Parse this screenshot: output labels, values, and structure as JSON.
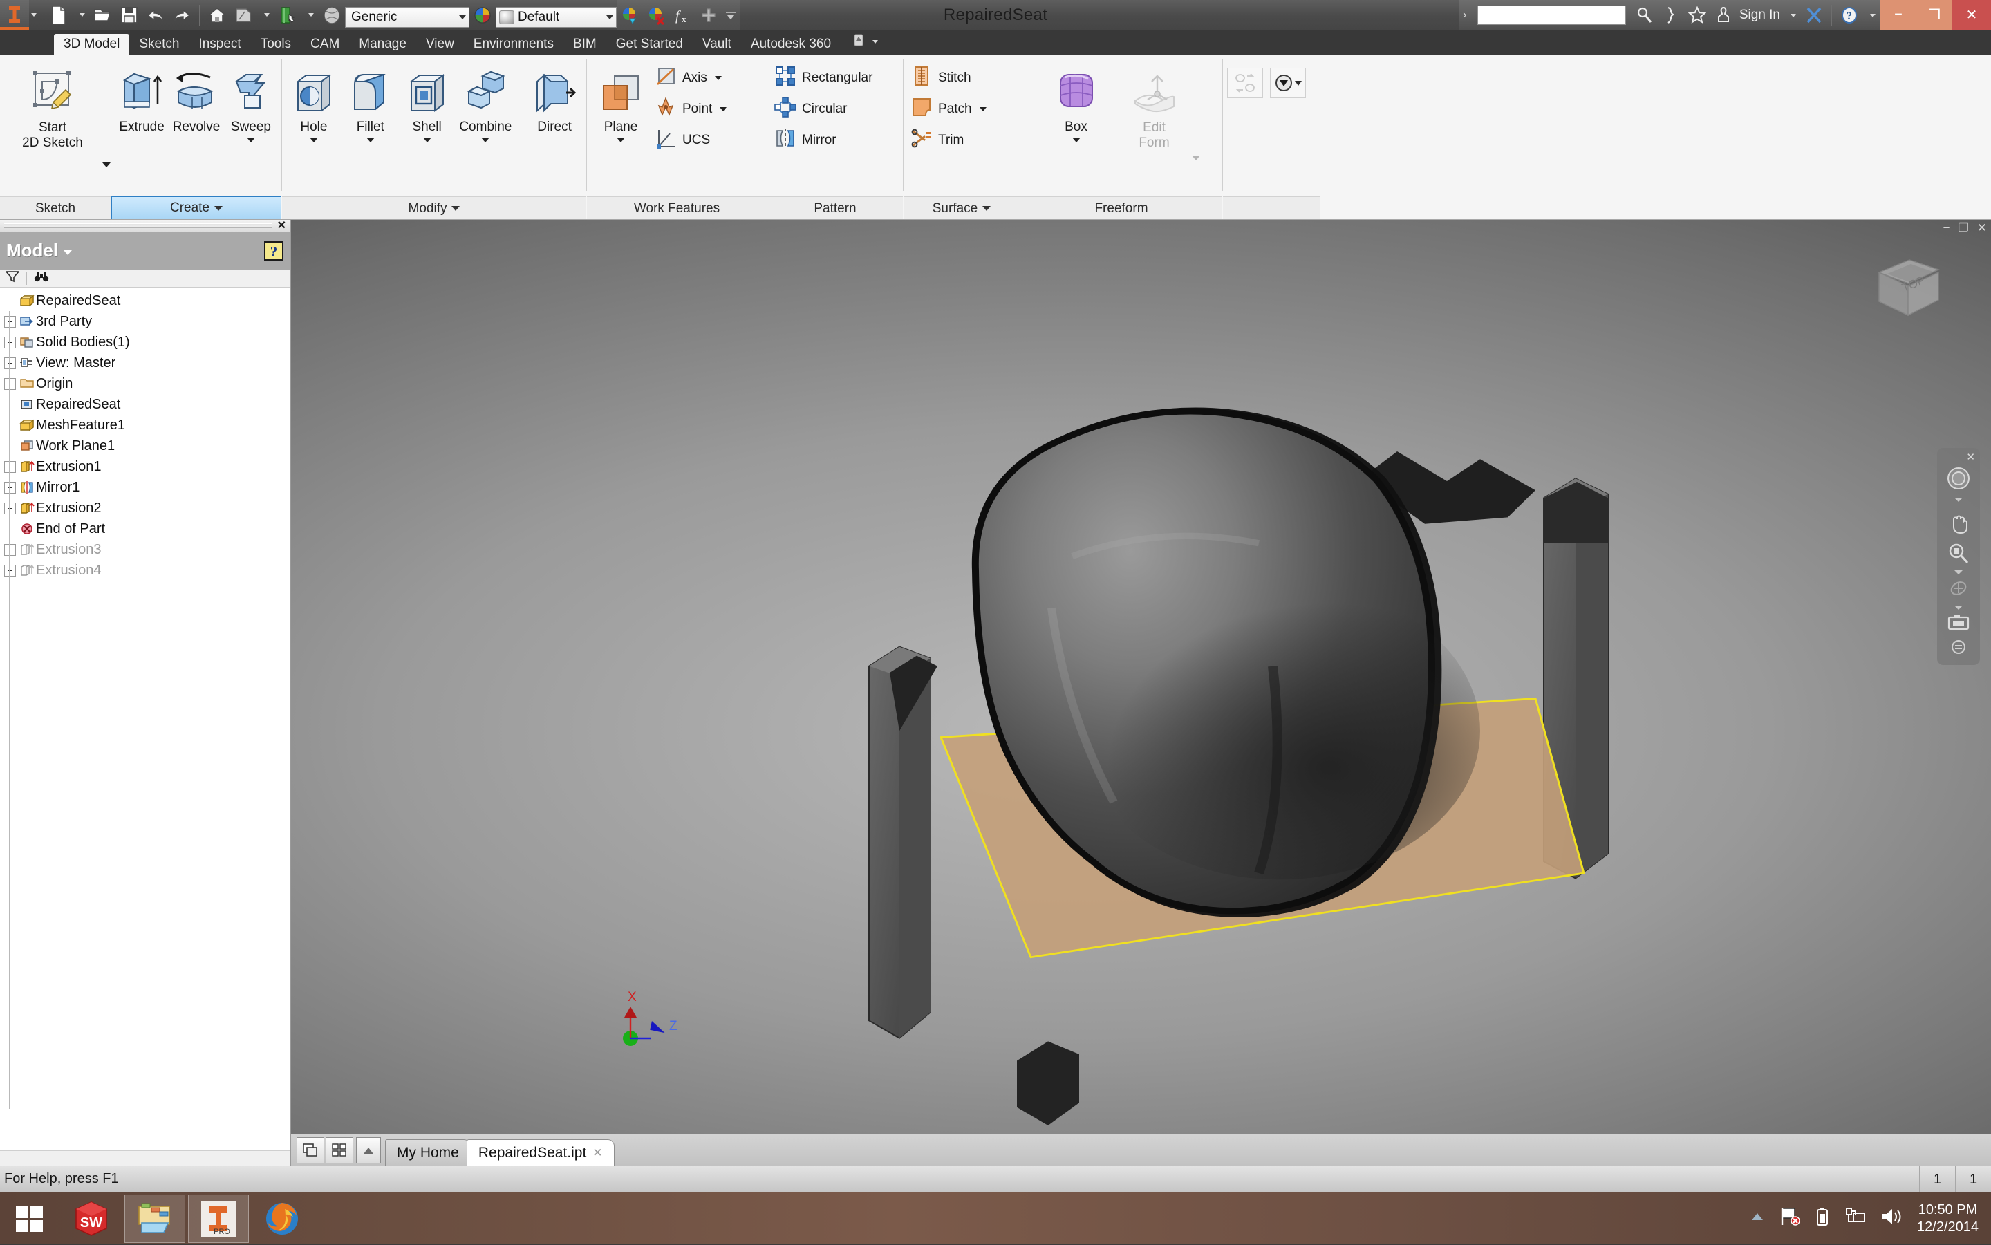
{
  "window": {
    "document_title": "RepairedSeat",
    "minimize_label": "−",
    "restore_label": "❐",
    "close_label": "✕",
    "accent_color": "#dd9272",
    "close_color": "#c9504f"
  },
  "quick_access": {
    "app_logo": "inventor-pro-logo",
    "buttons": [
      {
        "name": "new-file",
        "icon": "new-document-icon",
        "has_dropdown": true
      },
      {
        "name": "open-file",
        "icon": "open-folder-icon",
        "has_dropdown": false
      },
      {
        "name": "save-file",
        "icon": "save-disk-icon",
        "has_dropdown": false
      },
      {
        "name": "undo",
        "icon": "undo-arrow-icon",
        "has_dropdown": false
      },
      {
        "name": "redo",
        "icon": "redo-arrow-icon",
        "has_dropdown": false
      },
      {
        "name": "home",
        "icon": "home-icon",
        "has_dropdown": false
      },
      {
        "name": "return",
        "icon": "return-icon",
        "has_dropdown": true
      },
      {
        "name": "update",
        "icon": "green-book-icon",
        "has_dropdown": true
      },
      {
        "name": "material-browser",
        "icon": "sphere-material-icon",
        "has_dropdown": false
      }
    ],
    "material": {
      "label": "Generic",
      "value": "Generic"
    },
    "appearance": {
      "label": "Default",
      "value": "Default"
    },
    "appearance_tools": [
      {
        "name": "adjust-appearance",
        "icon": "color-wheel-dropper-icon"
      },
      {
        "name": "clear-appearance",
        "icon": "color-wheel-remove-icon"
      },
      {
        "name": "parameters",
        "icon": "fx-icon"
      },
      {
        "name": "add-parameter",
        "icon": "plus-icon"
      },
      {
        "name": "parameters-dropdown",
        "icon": "chevron-down-icon"
      }
    ]
  },
  "title_right": {
    "search_value": "",
    "search_placeholder": "",
    "icons": [
      {
        "name": "search-icon"
      },
      {
        "name": "help-sign-icon"
      },
      {
        "name": "favorites-star-icon"
      },
      {
        "name": "user-account-icon"
      }
    ],
    "sign_in_label": "Sign In",
    "exchange_label": "X",
    "help_label": "?"
  },
  "ribbon": {
    "tabs": [
      {
        "label": "3D Model",
        "active": true
      },
      {
        "label": "Sketch",
        "active": false
      },
      {
        "label": "Inspect",
        "active": false
      },
      {
        "label": "Tools",
        "active": false
      },
      {
        "label": "CAM",
        "active": false
      },
      {
        "label": "Manage",
        "active": false
      },
      {
        "label": "View",
        "active": false
      },
      {
        "label": "Environments",
        "active": false
      },
      {
        "label": "BIM",
        "active": false
      },
      {
        "label": "Get Started",
        "active": false
      },
      {
        "label": "Vault",
        "active": false
      },
      {
        "label": "Autodesk 360",
        "active": false
      }
    ],
    "panels": [
      {
        "name": "sketch",
        "label": "Sketch",
        "label_caret": false,
        "active": false,
        "big_buttons": [
          {
            "name": "start-2d-sketch",
            "line1": "Start",
            "line2": "2D Sketch",
            "icon": "sketch-pencil-icon",
            "dropdown": true,
            "disabled": false
          }
        ]
      },
      {
        "name": "create",
        "label": "Create",
        "label_caret": true,
        "active": true,
        "big_buttons": [
          {
            "name": "extrude",
            "line1": "Extrude",
            "line2": "",
            "icon": "extrude-icon",
            "dropdown": false,
            "disabled": false
          },
          {
            "name": "revolve",
            "line1": "Revolve",
            "line2": "",
            "icon": "revolve-icon",
            "dropdown": false,
            "disabled": false
          },
          {
            "name": "sweep",
            "line1": "Sweep",
            "line2": "",
            "icon": "sweep-icon",
            "dropdown": true,
            "disabled": false
          }
        ]
      },
      {
        "name": "modify",
        "label": "Modify",
        "label_caret": true,
        "active": false,
        "big_buttons": [
          {
            "name": "hole",
            "line1": "Hole",
            "line2": "",
            "icon": "hole-icon",
            "dropdown": true,
            "disabled": false
          },
          {
            "name": "fillet",
            "line1": "Fillet",
            "line2": "",
            "icon": "fillet-icon",
            "dropdown": true,
            "disabled": false
          },
          {
            "name": "shell",
            "line1": "Shell",
            "line2": "",
            "icon": "shell-icon",
            "dropdown": true,
            "disabled": false
          },
          {
            "name": "combine",
            "line1": "Combine",
            "line2": "",
            "icon": "combine-icon",
            "dropdown": true,
            "disabled": false
          },
          {
            "name": "direct",
            "line1": "Direct",
            "line2": "",
            "icon": "direct-edit-icon",
            "dropdown": false,
            "disabled": false
          }
        ]
      },
      {
        "name": "work-features",
        "label": "Work Features",
        "label_caret": false,
        "active": false,
        "big_buttons": [
          {
            "name": "plane",
            "line1": "Plane",
            "line2": "",
            "icon": "work-plane-icon",
            "dropdown": true,
            "disabled": false
          }
        ],
        "small_buttons": [
          {
            "name": "axis",
            "label": "Axis",
            "icon": "work-axis-icon",
            "dropdown": true
          },
          {
            "name": "point",
            "label": "Point",
            "icon": "work-point-icon",
            "dropdown": true
          },
          {
            "name": "ucs",
            "label": "UCS",
            "icon": "ucs-icon",
            "dropdown": false
          }
        ]
      },
      {
        "name": "pattern",
        "label": "Pattern",
        "label_caret": false,
        "active": false,
        "small_buttons": [
          {
            "name": "rectangular-pattern",
            "label": "Rectangular",
            "icon": "rectangular-pattern-icon",
            "dropdown": false
          },
          {
            "name": "circular-pattern",
            "label": "Circular",
            "icon": "circular-pattern-icon",
            "dropdown": false
          },
          {
            "name": "mirror",
            "label": "Mirror",
            "icon": "mirror-icon",
            "dropdown": false
          }
        ]
      },
      {
        "name": "surface",
        "label": "Surface",
        "label_caret": true,
        "active": false,
        "small_buttons": [
          {
            "name": "stitch",
            "label": "Stitch",
            "icon": "stitch-icon",
            "dropdown": false
          },
          {
            "name": "patch",
            "label": "Patch",
            "icon": "patch-icon",
            "dropdown": true
          },
          {
            "name": "trim",
            "label": "Trim",
            "icon": "trim-scissors-icon",
            "dropdown": false
          }
        ]
      },
      {
        "name": "freeform",
        "label": "Freeform",
        "label_caret": false,
        "active": false,
        "big_buttons": [
          {
            "name": "box",
            "line1": "Box",
            "line2": "",
            "icon": "freeform-box-icon",
            "dropdown": true,
            "disabled": false
          },
          {
            "name": "edit-form",
            "line1": "Edit",
            "line2": "Form",
            "icon": "edit-form-icon",
            "dropdown": true,
            "disabled": true
          }
        ]
      },
      {
        "name": "convert",
        "label": "",
        "label_caret": false,
        "active": false,
        "square_buttons": [
          {
            "name": "convert-to-sheet-metal",
            "icon": "convert-icon",
            "disabled": true
          },
          {
            "name": "appearance-override",
            "icon": "appearance-dropdown-icon",
            "disabled": false
          }
        ]
      }
    ]
  },
  "browser": {
    "panel_title": "Model",
    "help_icon": "help-question-icon",
    "tools": [
      {
        "name": "filter-icon"
      },
      {
        "name": "find-binoculars-icon"
      }
    ],
    "close_label": "✕",
    "tree": [
      {
        "label": "RepairedSeat",
        "icon": "part-icon",
        "expander": "none",
        "indent": 0,
        "ghost": false
      },
      {
        "label": "3rd Party",
        "icon": "third-party-icon",
        "expander": "+",
        "indent": 1,
        "ghost": false
      },
      {
        "label": "Solid Bodies(1)",
        "icon": "solid-bodies-icon",
        "expander": "+",
        "indent": 1,
        "ghost": false
      },
      {
        "label": "View: Master",
        "icon": "view-master-icon",
        "expander": "+",
        "indent": 1,
        "ghost": false
      },
      {
        "label": "Origin",
        "icon": "origin-folder-icon",
        "expander": "+",
        "indent": 1,
        "ghost": false
      },
      {
        "label": "RepairedSeat",
        "icon": "mesh-reference-icon",
        "expander": "none",
        "indent": 1,
        "ghost": false
      },
      {
        "label": "MeshFeature1",
        "icon": "mesh-feature-icon",
        "expander": "none",
        "indent": 1,
        "ghost": false
      },
      {
        "label": "Work Plane1",
        "icon": "work-plane-small-icon",
        "expander": "none",
        "indent": 1,
        "ghost": false
      },
      {
        "label": "Extrusion1",
        "icon": "extrusion-icon",
        "expander": "+",
        "indent": 1,
        "ghost": false
      },
      {
        "label": "Mirror1",
        "icon": "mirror-small-icon",
        "expander": "+",
        "indent": 1,
        "ghost": false
      },
      {
        "label": "Extrusion2",
        "icon": "extrusion-icon",
        "expander": "+",
        "indent": 1,
        "ghost": false
      },
      {
        "label": "End of Part",
        "icon": "end-of-part-icon",
        "expander": "none",
        "indent": 1,
        "ghost": false
      },
      {
        "label": "Extrusion3",
        "icon": "extrusion-ghost-icon",
        "expander": "+",
        "indent": 1,
        "ghost": true
      },
      {
        "label": "Extrusion4",
        "icon": "extrusion-ghost-icon",
        "expander": "+",
        "indent": 1,
        "ghost": true
      }
    ]
  },
  "viewport": {
    "viewcube_face": "TOP",
    "nav_tools": [
      {
        "name": "steering-wheel-icon"
      },
      {
        "name": "pan-hand-icon"
      },
      {
        "name": "zoom-magnifier-icon"
      },
      {
        "name": "orbit-icon"
      },
      {
        "name": "look-at-camera-icon"
      },
      {
        "name": "nav-settings-icon"
      }
    ],
    "axis_labels": {
      "x": "X",
      "z": "Z"
    },
    "axis_colors": {
      "x": "#d02020",
      "y": "#18b018",
      "z": "#2020d8"
    },
    "model_highlight_color": "#e8e000",
    "minimize_label": "−",
    "restore_label": "❐",
    "close_label": "✕"
  },
  "doc_tabs": {
    "left_buttons": [
      {
        "name": "cascade-windows-icon"
      },
      {
        "name": "tile-windows-icon"
      },
      {
        "name": "scroll-up-icon"
      }
    ],
    "tabs": [
      {
        "label": "My Home",
        "active": false,
        "closable": false
      },
      {
        "label": "RepairedSeat.ipt",
        "active": true,
        "closable": true
      }
    ]
  },
  "status_bar": {
    "message": "For Help, press F1",
    "cells": [
      "1",
      "1"
    ]
  },
  "taskbar": {
    "start_label": "start-windows-icon",
    "items": [
      {
        "name": "solidworks-taskbar-icon",
        "open": false
      },
      {
        "name": "file-explorer-taskbar-icon",
        "open": true
      },
      {
        "name": "inventor-pro-taskbar-icon",
        "open": true,
        "badge": "PRO"
      },
      {
        "name": "firefox-taskbar-icon",
        "open": false
      }
    ],
    "tray": [
      {
        "name": "show-hidden-icons-icon"
      },
      {
        "name": "action-center-flag-icon"
      },
      {
        "name": "battery-icon"
      },
      {
        "name": "network-icon"
      },
      {
        "name": "volume-icon"
      }
    ],
    "clock_time": "10:50 PM",
    "clock_date": "12/2/2014"
  }
}
